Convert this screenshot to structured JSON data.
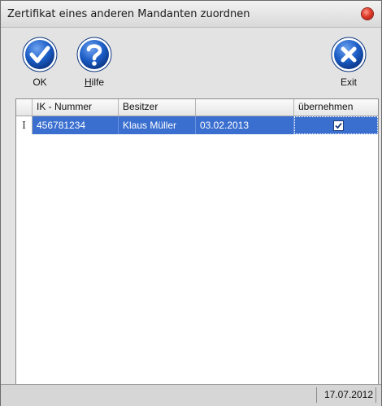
{
  "window": {
    "title": "Zertifikat eines anderen Mandanten zuordnen"
  },
  "toolbar": {
    "ok_label": "OK",
    "hilfe_label": "Hilfe",
    "exit_label": "Exit"
  },
  "grid": {
    "columns": [
      "IK - Nummer",
      "Besitzer",
      "",
      "übernehmen"
    ],
    "rows": [
      {
        "indicator": "I",
        "ik_nummer": "456781234",
        "besitzer": "Klaus Müller",
        "datum": "03.02.2013",
        "uebernehmen": true
      }
    ]
  },
  "statusbar": {
    "date": "17.07.2012"
  },
  "colors": {
    "selection": "#3a6fd0",
    "accent_blue": "#1b5dc6",
    "close_red": "#e03a2a"
  },
  "icons": {
    "ok": "check-circle-icon",
    "hilfe": "question-circle-icon",
    "exit": "x-circle-icon",
    "close": "close-icon"
  }
}
